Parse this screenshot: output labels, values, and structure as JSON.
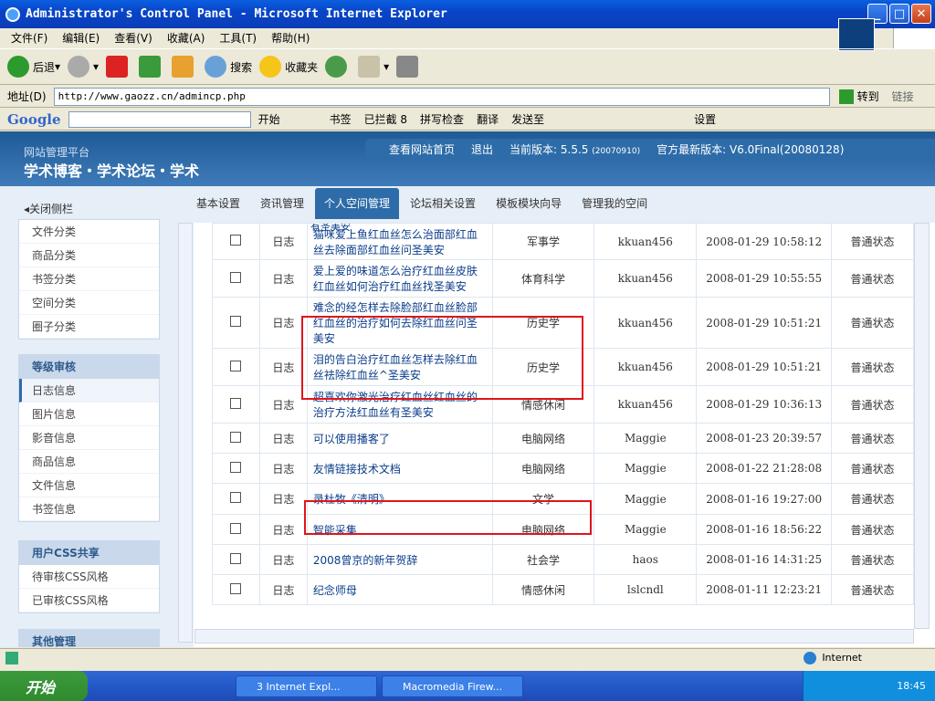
{
  "window": {
    "title": "Administrator's Control Panel - Microsoft Internet Explorer"
  },
  "menus": [
    "文件(F)",
    "编辑(E)",
    "查看(V)",
    "收藏(A)",
    "工具(T)",
    "帮助(H)"
  ],
  "toolbar": {
    "back": "后退",
    "search": "搜索",
    "favorites": "收藏夹"
  },
  "address": {
    "label": "地址(D)",
    "url": "http://www.gaozz.cn/admincp.php",
    "go": "转到",
    "links": "链接"
  },
  "google": {
    "logo": "Google",
    "start": "开始",
    "bookmarks": "书签",
    "blocked": "已拦截 8",
    "spellcheck": "拼写检查",
    "translate": "翻译",
    "sendto": "发送至",
    "settings": "设置"
  },
  "header": {
    "site_small": "网站管理平台",
    "site_big": "学术博客・学术论坛・学术",
    "link_home": "查看网站首页",
    "link_logout": "退出",
    "version": "当前版本: 5.5.5",
    "version_date": "(20070910)",
    "latest": "官方最新版本:",
    "latest_val": "V6.0Final(20080128)",
    "collapse": "关闭侧栏"
  },
  "tabs": [
    "基本设置",
    "资讯管理",
    "个人空间管理",
    "论坛相关设置",
    "模板模块向导",
    "管理我的空间"
  ],
  "sidebar": {
    "group1": [
      "文件分类",
      "商品分类",
      "书签分类",
      "空间分类",
      "圈子分类"
    ],
    "group2_title": "等级审核",
    "group2": [
      "日志信息",
      "图片信息",
      "影音信息",
      "商品信息",
      "文件信息",
      "书签信息"
    ],
    "group3_title": "用户CSS共享",
    "group3": [
      "待审核CSS风格",
      "已审核CSS风格"
    ],
    "group4_title": "其他管理"
  },
  "table": {
    "cut_text": "有圣美安",
    "rows": [
      {
        "type": "日志",
        "title": "猫咪爱上鱼红血丝怎么治面部红血丝去除面部红血丝问圣美安",
        "cat": "军事学",
        "author": "kkuan456",
        "time": "2008-01-29 10:58:12",
        "status": "普通状态"
      },
      {
        "type": "日志",
        "title": "爱上爱的味道怎么治疗红血丝皮肤红血丝如何治疗红血丝找圣美安",
        "cat": "体育科学",
        "author": "kkuan456",
        "time": "2008-01-29 10:55:55",
        "status": "普通状态"
      },
      {
        "type": "日志",
        "title": "难念的经怎样去除脸部红血丝脸部红血丝的治疗如何去除红血丝问圣美安",
        "cat": "历史学",
        "author": "kkuan456",
        "time": "2008-01-29 10:51:21",
        "status": "普通状态"
      },
      {
        "type": "日志",
        "title": "泪的告白治疗红血丝怎样去除红血丝祛除红血丝^圣美安",
        "cat": "历史学",
        "author": "kkuan456",
        "time": "2008-01-29 10:51:21",
        "status": "普通状态"
      },
      {
        "type": "日志",
        "title": "超喜欢你激光治疗红血丝红血丝的治疗方法红血丝有圣美安",
        "cat": "情感休闲",
        "author": "kkuan456",
        "time": "2008-01-29 10:36:13",
        "status": "普通状态"
      },
      {
        "type": "日志",
        "title": "可以使用播客了",
        "cat": "电脑网络",
        "author": "Maggie",
        "time": "2008-01-23 20:39:57",
        "status": "普通状态"
      },
      {
        "type": "日志",
        "title": "友情链接技术文档",
        "cat": "电脑网络",
        "author": "Maggie",
        "time": "2008-01-22 21:28:08",
        "status": "普通状态"
      },
      {
        "type": "日志",
        "title": "录杜牧《清明》",
        "cat": "文学",
        "author": "Maggie",
        "time": "2008-01-16 19:27:00",
        "status": "普通状态"
      },
      {
        "type": "日志",
        "title": "智能采集",
        "cat": "电脑网络",
        "author": "Maggie",
        "time": "2008-01-16 18:56:22",
        "status": "普通状态"
      },
      {
        "type": "日志",
        "title": "2008曾京的新年贺辞",
        "cat": "社会学",
        "author": "haos",
        "time": "2008-01-16 14:31:25",
        "status": "普通状态"
      },
      {
        "type": "日志",
        "title": "纪念师母",
        "cat": "情感休闲",
        "author": "lslcndl",
        "time": "2008-01-11 12:23:21",
        "status": "普通状态"
      }
    ]
  },
  "statusbar": {
    "zone": "Internet"
  },
  "taskbar": {
    "start": "开始",
    "task1": "3 Internet Expl...",
    "task2": "Macromedia Firew...",
    "clock": "18:45"
  }
}
